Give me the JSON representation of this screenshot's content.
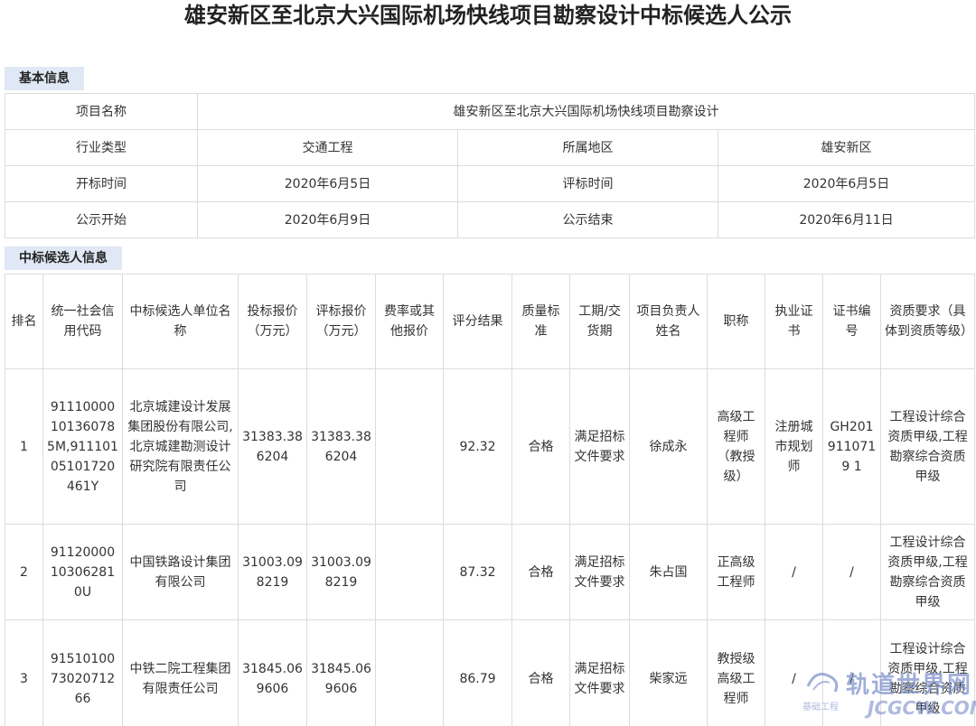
{
  "title": "雄安新区至北京大兴国际机场快线项目勘察设计中标候选人公示",
  "basic_section_label": "基本信息",
  "basic": {
    "project_name_label": "项目名称",
    "project_name": "雄安新区至北京大兴国际机场快线项目勘察设计",
    "industry_label": "行业类型",
    "industry": "交通工程",
    "region_label": "所属地区",
    "region": "雄安新区",
    "open_time_label": "开标时间",
    "open_time": "2020年6月5日",
    "eval_time_label": "评标时间",
    "eval_time": "2020年6月5日",
    "pub_start_label": "公示开始",
    "pub_start": "2020年6月9日",
    "pub_end_label": "公示结束",
    "pub_end": "2020年6月11日"
  },
  "candidates_section_label": "中标候选人信息",
  "columns": [
    "排名",
    "统一社会信用代码",
    "中标候选人单位名称",
    "投标报价（万元）",
    "评标报价（万元）",
    "费率或其他报价",
    "评分结果",
    "质量标准",
    "工期/交货期",
    "项目负责人姓名",
    "职称",
    "执业证书",
    "证书编号",
    "资质要求（具体到资质等级）"
  ],
  "rows": [
    {
      "rank": "1",
      "credit_code": "91110000101360785M,91110105101720461Y",
      "company": "北京城建设计发展集团股份有限公司,北京城建勘测设计研究院有限责任公司",
      "bid_price": "31383.386204",
      "eval_price": "31383.386204",
      "rate": "",
      "score": "92.32",
      "quality": "合格",
      "period": "满足招标文件要求",
      "manager": "徐成永",
      "title": "高级工程师（教授级）",
      "license": "注册城市规划师",
      "cert_no": "GH2019110719 1",
      "qualification": "工程设计综合资质甲级,工程勘察综合资质甲级"
    },
    {
      "rank": "2",
      "credit_code": "91120000103062810U",
      "company": "中国铁路设计集团有限公司",
      "bid_price": "31003.098219",
      "eval_price": "31003.098219",
      "rate": "",
      "score": "87.32",
      "quality": "合格",
      "period": "满足招标文件要求",
      "manager": "朱占国",
      "title": "正高级工程师",
      "license": "/",
      "cert_no": "/",
      "qualification": "工程设计综合资质甲级,工程勘察综合资质甲级"
    },
    {
      "rank": "3",
      "credit_code": "915101007302071266",
      "company": "中铁二院工程集团有限责任公司",
      "bid_price": "31845.069606",
      "eval_price": "31845.069606",
      "rate": "",
      "score": "86.79",
      "quality": "合格",
      "period": "满足招标文件要求",
      "manager": "柴家远",
      "title": "教授级高级工程师",
      "license": "/",
      "cert_no": "/",
      "qualification": "工程设计综合资质甲级,工程勘察综合资质甲级"
    }
  ],
  "watermark": {
    "main": "轨道世界网",
    "url": "JCGCW.COM",
    "small": "基础工程"
  }
}
